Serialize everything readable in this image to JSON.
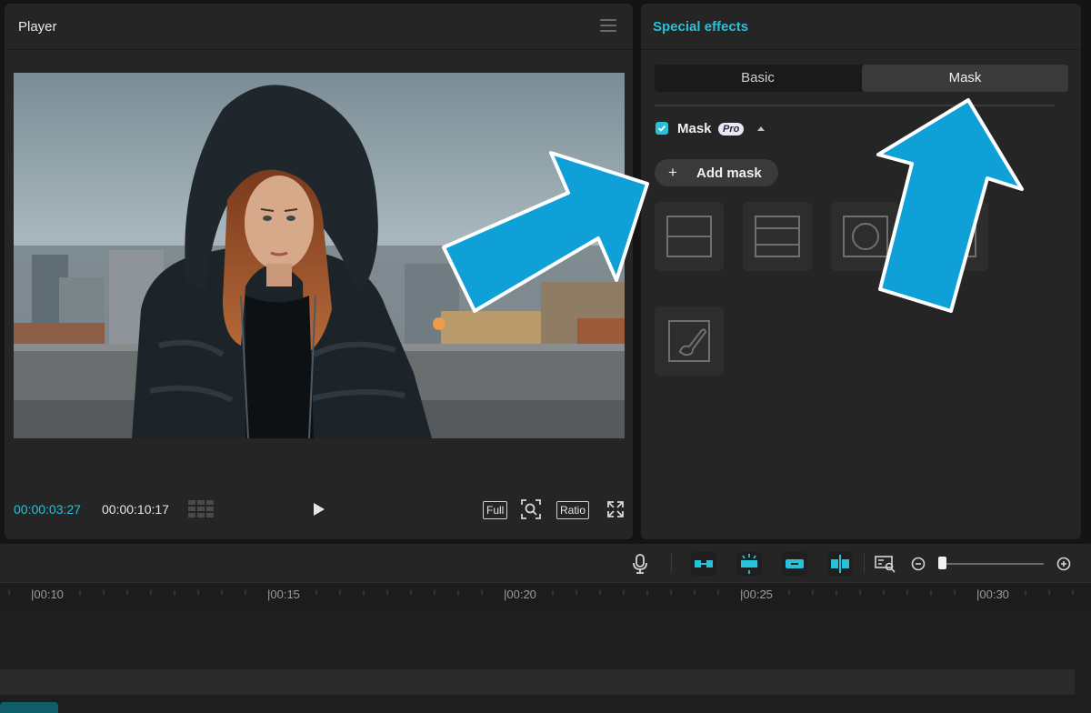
{
  "player": {
    "title": "Player",
    "current_time": "00:00:03:27",
    "total_time": "00:00:10:17",
    "full_label": "Full",
    "ratio_label": "Ratio"
  },
  "effects": {
    "title": "Special effects",
    "tabs": [
      {
        "label": "Basic",
        "active": false
      },
      {
        "label": "Mask",
        "active": true
      }
    ],
    "mask_section": {
      "label": "Mask",
      "badge": "Pro",
      "checked": true
    },
    "add_mask_label": "Add mask",
    "mask_shapes": [
      "split-mask-icon",
      "filmstrip-mask-icon",
      "circle-mask-icon",
      "rectangle-mask-icon",
      "brush-mask-icon"
    ]
  },
  "timeline": {
    "ruler_labels": [
      "|00:10",
      "|00:15",
      "|00:20",
      "|00:25",
      "|00:30"
    ]
  },
  "colors": {
    "accent": "#27c2d8",
    "annotation_arrow": "#0fa0d8"
  }
}
